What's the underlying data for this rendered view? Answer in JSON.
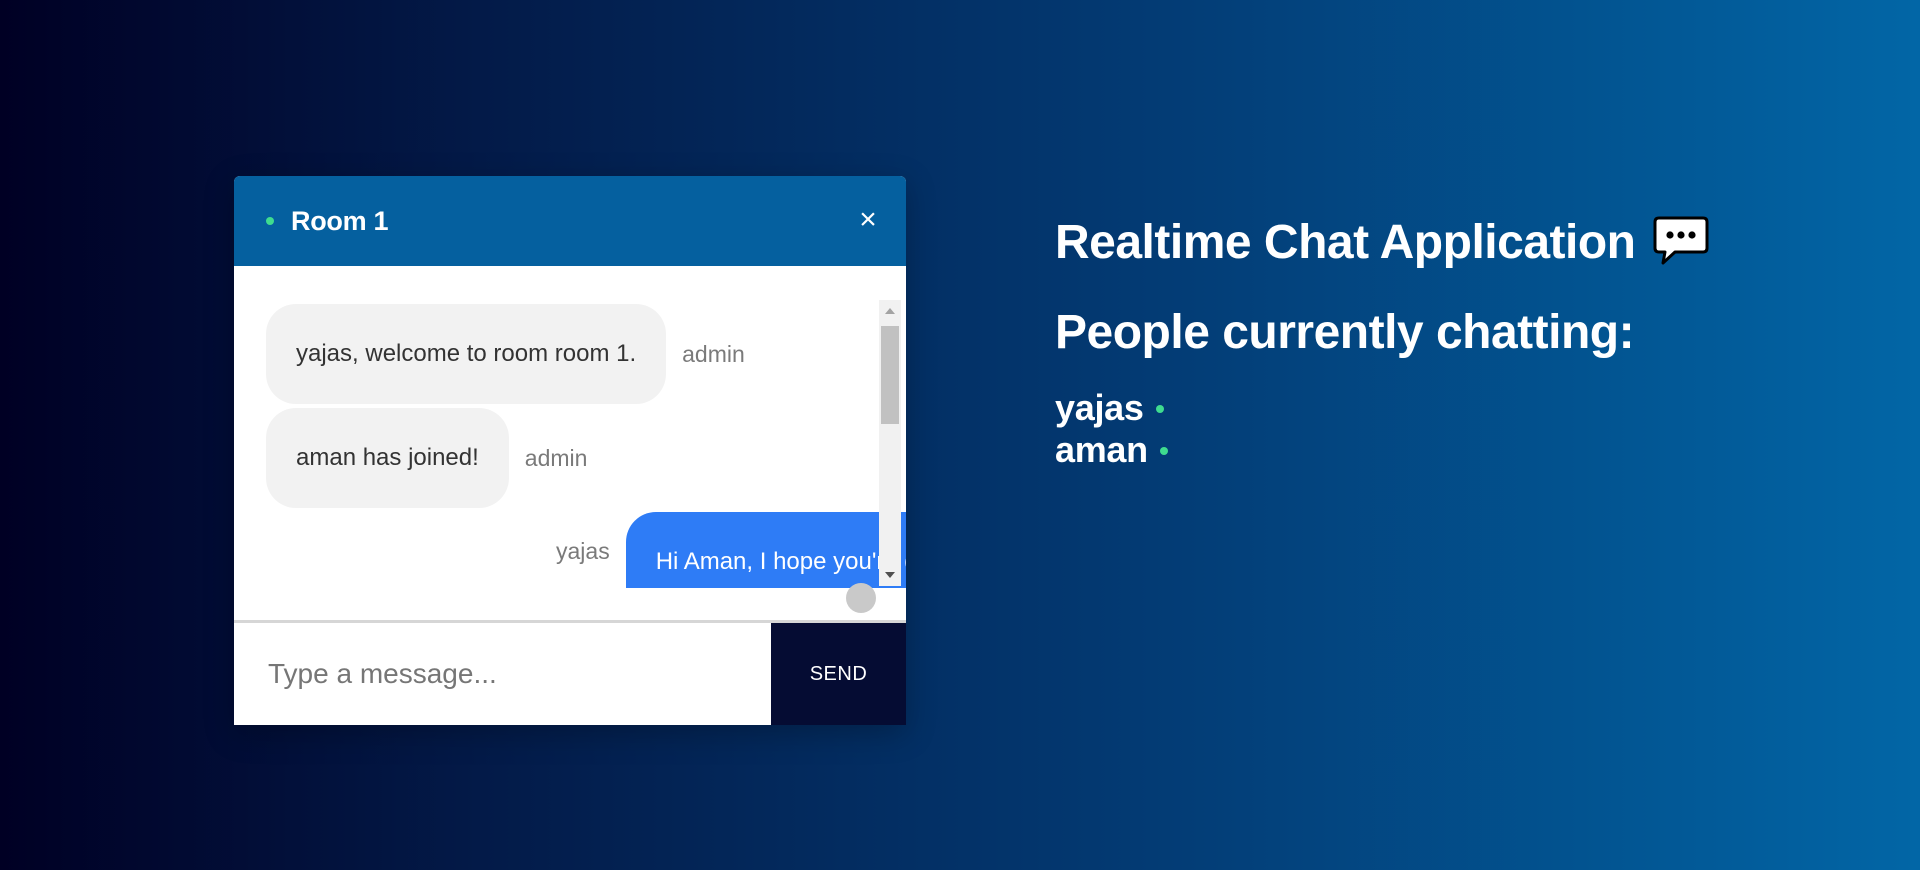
{
  "chat": {
    "room_title": "Room 1",
    "close_label": "×",
    "messages": [
      {
        "text": "yajas, welcome to room room 1.",
        "sender": "admin",
        "mine": false
      },
      {
        "text": "aman has joined!",
        "sender": "admin",
        "mine": false
      },
      {
        "text": "Hi Aman, I hope you're doing well!",
        "sender": "yajas",
        "mine": true
      }
    ],
    "input_placeholder": "Type a message...",
    "input_value": "",
    "send_label": "SEND"
  },
  "info": {
    "title": "Realtime Chat Application",
    "title_icon": "speech-bubble-icon",
    "people_heading": "People currently chatting:",
    "users": [
      {
        "name": "yajas",
        "status": "online"
      },
      {
        "name": "aman",
        "status": "online"
      }
    ]
  },
  "colors": {
    "header": "#05609f",
    "own_bubble": "#2e7cf6",
    "other_bubble": "#f2f2f2",
    "send_button": "#050c33",
    "online": "#3fdc8f",
    "background_start": "#000024",
    "background_end": "#0266a6"
  }
}
